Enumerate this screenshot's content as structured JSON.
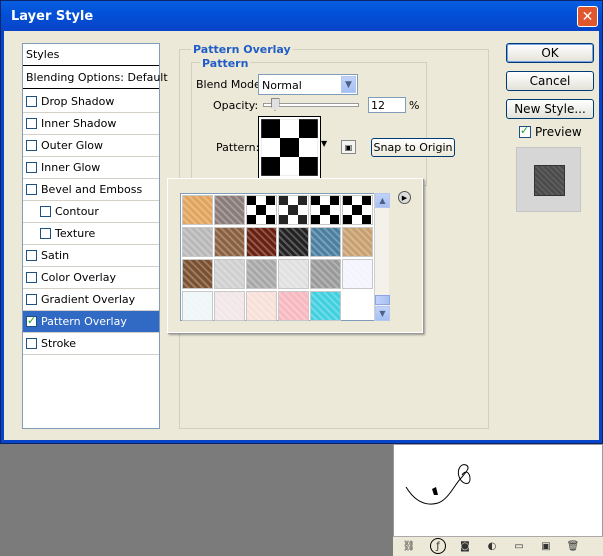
{
  "window": {
    "title": "Layer Style",
    "close_glyph": "✕"
  },
  "styles_list": {
    "header": "Styles",
    "blending": "Blending Options: Default",
    "items": [
      {
        "label": "Drop Shadow"
      },
      {
        "label": "Inner Shadow"
      },
      {
        "label": "Outer Glow"
      },
      {
        "label": "Inner Glow"
      },
      {
        "label": "Bevel and Emboss"
      },
      {
        "label": "Contour"
      },
      {
        "label": "Texture"
      },
      {
        "label": "Satin"
      },
      {
        "label": "Color Overlay"
      },
      {
        "label": "Gradient Overlay"
      },
      {
        "label": "Pattern Overlay"
      },
      {
        "label": "Stroke"
      }
    ]
  },
  "panel": {
    "title": "Pattern Overlay",
    "subtitle": "Pattern",
    "blend_mode_label": "Blend Mode:",
    "blend_mode_value": "Normal",
    "opacity_label": "Opacity:",
    "opacity_value": "12",
    "opacity_unit": "%",
    "opacity_fraction": 0.12,
    "pattern_label": "Pattern:",
    "snap_button": "Snap to Origin"
  },
  "buttons": {
    "ok": "OK",
    "cancel": "Cancel",
    "new_style": "New Style...",
    "preview": "Preview"
  },
  "picker": {
    "tiles": [
      "wood-light",
      "gray-gradient",
      "checker",
      "checker-gray",
      "checker",
      "checker-row",
      "clouds",
      "brown",
      "rust",
      "black-marble",
      "blue-swirl",
      "leaves",
      "brown-bark",
      "ornate",
      "ornate-gray",
      "paper",
      "metal",
      "blue-dots",
      "blue-strand",
      "pink-card",
      "pink-ornament",
      "pink-dots",
      "cyan-blocks"
    ],
    "colors": {
      "wood-light": "#e2a45c",
      "gray-gradient": "#8a7c78",
      "clouds": "#b8b8b8",
      "brown": "#8a6040",
      "rust": "#6a2010",
      "black-marble": "#222222",
      "blue-swirl": "#4a7fa0",
      "leaves": "#c8a070",
      "brown-bark": "#7a5030",
      "ornate": "#d0d0d0",
      "ornate-gray": "#a8a8a8",
      "paper": "#e0e0e0",
      "metal": "#9a9a9a",
      "blue-dots": "#f4f4ff",
      "blue-strand": "#eef6f8",
      "pink-card": "#f2e6e8",
      "pink-ornament": "#f8e0d8",
      "pink-dots": "#f8b8c0",
      "cyan-blocks": "#40d0e0"
    }
  },
  "toolbar_icons": [
    "link-icon",
    "fx-icon",
    "mask-icon",
    "adjustment-icon",
    "folder-icon",
    "new-layer-icon",
    "trash-icon"
  ]
}
